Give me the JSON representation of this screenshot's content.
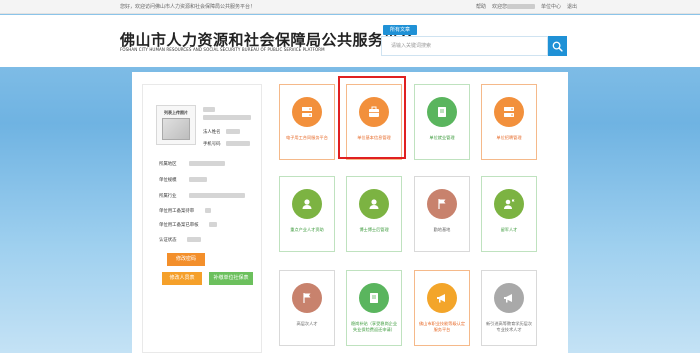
{
  "topbar": {
    "welcome": "您好，欢迎访问佛山市人力资源和社会保障局公共服务平台！",
    "help": "帮助",
    "greeting": "欢迎您",
    "unit_center": "单位中心",
    "logout": "退出"
  },
  "header": {
    "title_cn": "佛山市人力资源和社会保障局公共服务平台",
    "title_en": "FOSHAN CITY HUMAN RESOURCES AND SOCIAL SECURITY BUREAU OF PUBLIC SERVICE PLATFORM",
    "search_tab": "所有文章",
    "search_placeholder": "请输入关键词搜索"
  },
  "profile": {
    "avatar_caption": "列表上传照片",
    "fields": [
      {
        "label": "法人姓名"
      },
      {
        "label": "手机号码"
      },
      {
        "label": "所属地区"
      },
      {
        "label": "单位规模"
      },
      {
        "label": "所属行业"
      },
      {
        "label": "单位用工备案待审"
      },
      {
        "label": "单位用工备案已审核"
      },
      {
        "label": "认证状态"
      }
    ],
    "buttons": {
      "change_password": "修改密码",
      "alter_info": "修改人员表",
      "modify": "补缴单位社保表"
    }
  },
  "tiles": [
    {
      "label": "电子用工合同服务平台",
      "style": "hot",
      "color": "#f2903c",
      "icon": "server-icon"
    },
    {
      "label": "单位基本信息管理",
      "style": "hot",
      "color": "#f2903c",
      "icon": "briefcase-icon"
    },
    {
      "label": "单位就业管理",
      "style": "green",
      "color": "#5ab55e",
      "icon": "book-icon"
    },
    {
      "label": "单位招聘管理",
      "style": "hot",
      "color": "#f2903c",
      "icon": "server-icon"
    },
    {
      "label": "重点产业人才资助",
      "style": "green",
      "color": "#7cb342",
      "icon": "user-icon"
    },
    {
      "label": "博士博士后管理",
      "style": "green",
      "color": "#7cb342",
      "icon": "user-icon"
    },
    {
      "label": "勤地基地",
      "style": "gray",
      "color": "#c8826d",
      "icon": "flag-icon"
    },
    {
      "label": "留军人才",
      "style": "green",
      "color": "#7cb342",
      "icon": "person-flag-icon"
    },
    {
      "label": "高层次人才",
      "style": "gray",
      "color": "#c8826d",
      "icon": "flag-icon"
    },
    {
      "label": "稳岗补贴（享受稳岗企业失业保险费返还申请）",
      "style": "green",
      "color": "#5ab55e",
      "icon": "book-icon"
    },
    {
      "label": "佛山市职业技能等级认定服务平台",
      "style": "hot",
      "color": "#f3a52a",
      "icon": "megaphone-icon"
    },
    {
      "label": "新引进高等教育学历层次专业技术人才",
      "style": "gray",
      "color": "#a9a9a9",
      "icon": "megaphone-icon"
    }
  ]
}
